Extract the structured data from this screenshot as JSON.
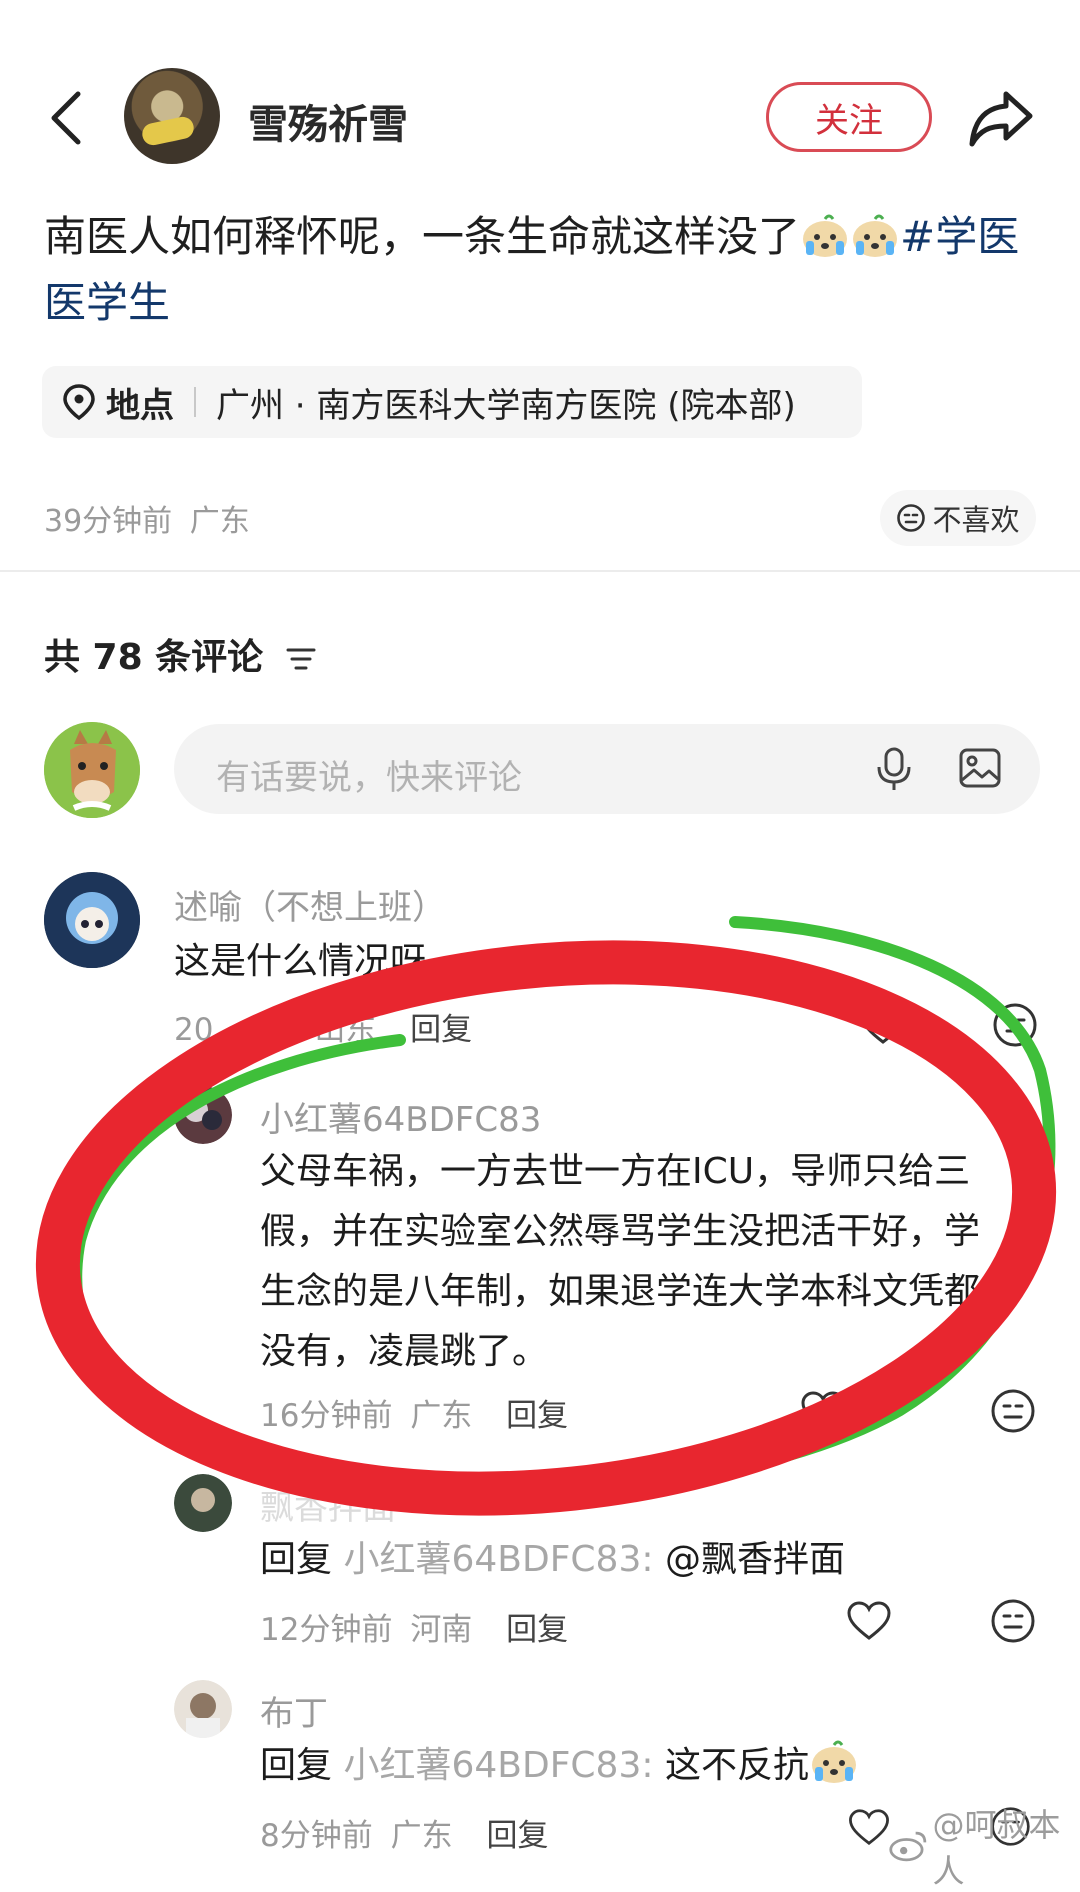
{
  "author": {
    "name": "雪殇祈雪",
    "follow_label": "关注"
  },
  "post": {
    "text": "南医人如何释怀呢，一条生命就这样没了",
    "tags_line1": "#学医",
    "tags_line2": "医学生",
    "location_label": "地点",
    "location_value": "广州 · 南方医科大学南方医院 (院本部)",
    "time": "39分钟前",
    "region": "广东",
    "dislike_label": "不喜欢"
  },
  "comments_header": {
    "count_label": "共 78 条评论"
  },
  "comment_input": {
    "placeholder": "有话要说，快来评论"
  },
  "comments": [
    {
      "name": "述喻（不想上班）",
      "text": "这是什么情况呀",
      "time": "20",
      "time_suffix": "前",
      "region": "山东",
      "reply_label": "回复"
    },
    {
      "name": "小红薯64BDFC83",
      "text": "父母车祸，一方去世一方在ICU，导师只给三假，并在实验室公然辱骂学生没把活干好，学生念的是八年制，如果退学连大学本科文凭都没有，凌晨跳了。",
      "time": "16分钟前",
      "region": "广东",
      "reply_label": "回复",
      "likes": "1"
    },
    {
      "name": "飘香拌面",
      "reply_prefix": "回复",
      "reply_to": "小红薯64BDFC83:",
      "at": "@飘香拌面",
      "time": "12分钟前",
      "region": "河南",
      "reply_label": "回复"
    },
    {
      "name": "布丁",
      "reply_prefix": "回复",
      "reply_to": "小红薯64BDFC83:",
      "text": "这不反抗",
      "time": "8分钟前",
      "region": "广东",
      "reply_label": "回复"
    }
  ],
  "watermark": "@呵叔本人",
  "colors": {
    "accent_red": "#d2303c",
    "tag_blue": "#13386b",
    "marker_red": "#e8262f",
    "marker_green": "#3fbf3a"
  },
  "icons": [
    "back-icon",
    "share-icon",
    "location-pin-icon",
    "neutral-face-icon",
    "filter-icon",
    "mic-icon",
    "image-icon",
    "heart-icon",
    "crying-emoji-icon",
    "weibo-logo-icon"
  ]
}
